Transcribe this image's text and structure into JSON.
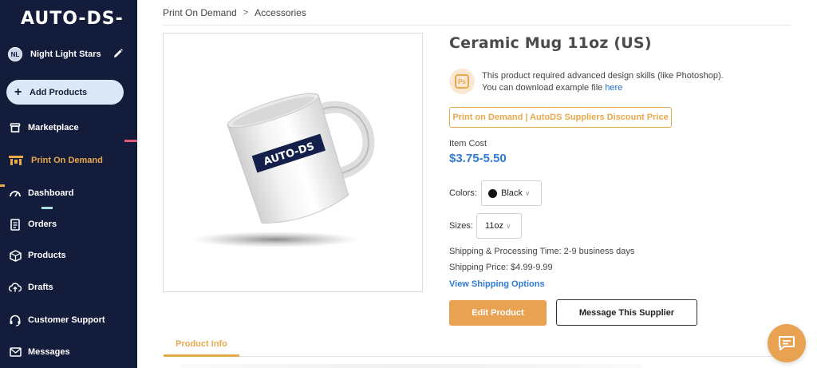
{
  "brand": {
    "logo": "AUTO-DS-"
  },
  "store": {
    "initials": "NL",
    "name": "Night Light Stars"
  },
  "sidebar": {
    "add_products": "Add Products",
    "items": [
      {
        "label": "Marketplace",
        "icon": "store-icon"
      },
      {
        "label": "Print On Demand",
        "icon": "pod-icon",
        "active": true
      },
      {
        "label": "Dashboard",
        "icon": "gauge-icon"
      },
      {
        "label": "Orders",
        "icon": "receipt-icon"
      },
      {
        "label": "Products",
        "icon": "box-icon"
      },
      {
        "label": "Drafts",
        "icon": "cloud-upload-icon"
      },
      {
        "label": "Customer Support",
        "icon": "headset-icon"
      },
      {
        "label": "Messages",
        "icon": "mail-icon"
      }
    ]
  },
  "breadcrumb": [
    "Print On Demand",
    "Accessories"
  ],
  "product": {
    "title": "Ceramic Mug 11oz (US)",
    "image_brand_text": "AUTO-DS",
    "skill_note_line1": "This product required advanced design skills (like Photoshop).",
    "skill_note_line2_prefix": "You can download example file ",
    "skill_note_link": "here",
    "ps_badge": "Ps",
    "discount_label": "Print on Demand | AutoDS Suppliers Discount Price",
    "item_cost_label": "Item Cost",
    "item_cost_value": "$3.75-5.50",
    "colors_label": "Colors:",
    "color_selected": "Black",
    "sizes_label": "Sizes:",
    "size_selected": "11oz",
    "shipping_time": "Shipping & Processing Time: 2-9 business days",
    "shipping_price": "Shipping Price: $4.99-9.99",
    "shipping_options_link": "View Shipping Options",
    "edit_button": "Edit Product",
    "message_button": "Message This Supplier"
  },
  "tabs": {
    "product_info": "Product Info"
  },
  "colors": {
    "sidebar_bg": "#131c3a",
    "accent": "#e8a94d",
    "link": "#2f7bd6"
  }
}
